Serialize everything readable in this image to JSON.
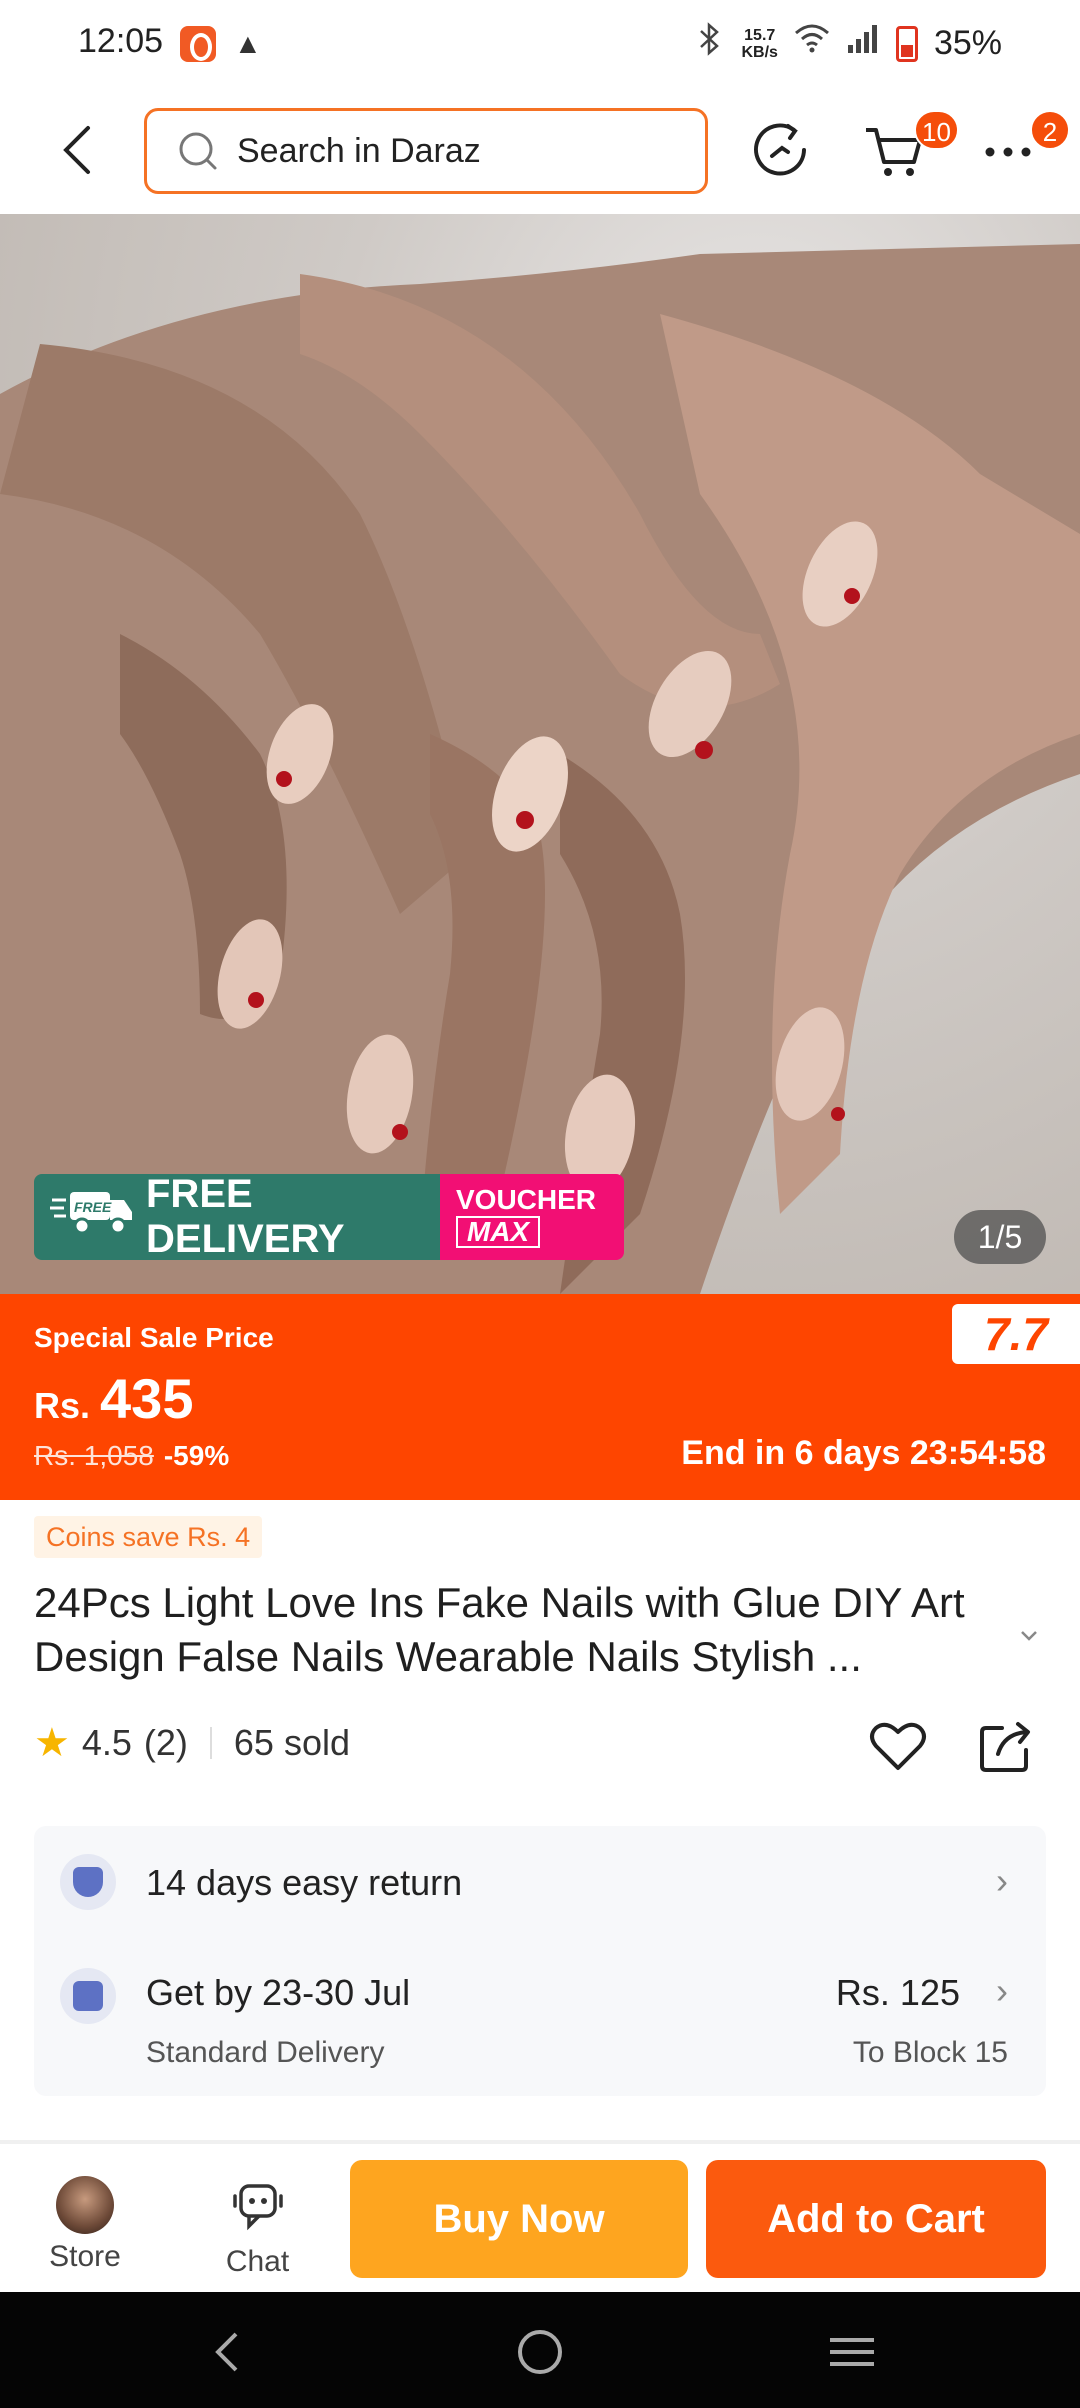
{
  "status_bar": {
    "time": "12:05",
    "net_speed_value": "15.7",
    "net_speed_unit": "KB/s",
    "battery": "35%",
    "icons": [
      "daraz-app-icon",
      "warning-icon",
      "bluetooth-icon",
      "wifi-icon",
      "signal-icon",
      "battery-icon"
    ]
  },
  "top_nav": {
    "search_placeholder": "Search in Daraz",
    "cart_count": "10",
    "more_count": "2"
  },
  "gallery": {
    "counter": "1/5",
    "free_delivery_label": "FREE DELIVERY",
    "free_tag": "FREE",
    "voucher_label": "VOUCHER",
    "voucher_max": "MAX"
  },
  "price": {
    "sale_label": "Special Sale Price",
    "currency": "Rs.",
    "amount": "435",
    "original": "Rs. 1,058",
    "discount": "-59%",
    "timer": "End in 6 days 23:54:58",
    "event_logo": "7.7"
  },
  "product": {
    "coins_save": "Coins save Rs. 4",
    "title": "24Pcs Light Love Ins Fake Nails with Glue DIY Art Design False Nails Wearable Nails Stylish ...",
    "rating": "4.5",
    "reviews": "(2)",
    "sold": "65 sold"
  },
  "services": {
    "return": "14 days easy return",
    "delivery_date": "Get by 23-30 Jul",
    "delivery_type": "Standard Delivery",
    "delivery_fee": "Rs. 125",
    "delivery_dest": "To Block 15"
  },
  "action_bar": {
    "store_label": "Store",
    "chat_label": "Chat",
    "buy_now": "Buy Now",
    "add_to_cart": "Add to Cart"
  },
  "colors": {
    "brand_orange": "#fe4500",
    "buy_now": "#fea51f",
    "add_to_cart": "#fb5a0e",
    "free_delivery": "#2e7a6a",
    "voucher": "#f20f74"
  }
}
